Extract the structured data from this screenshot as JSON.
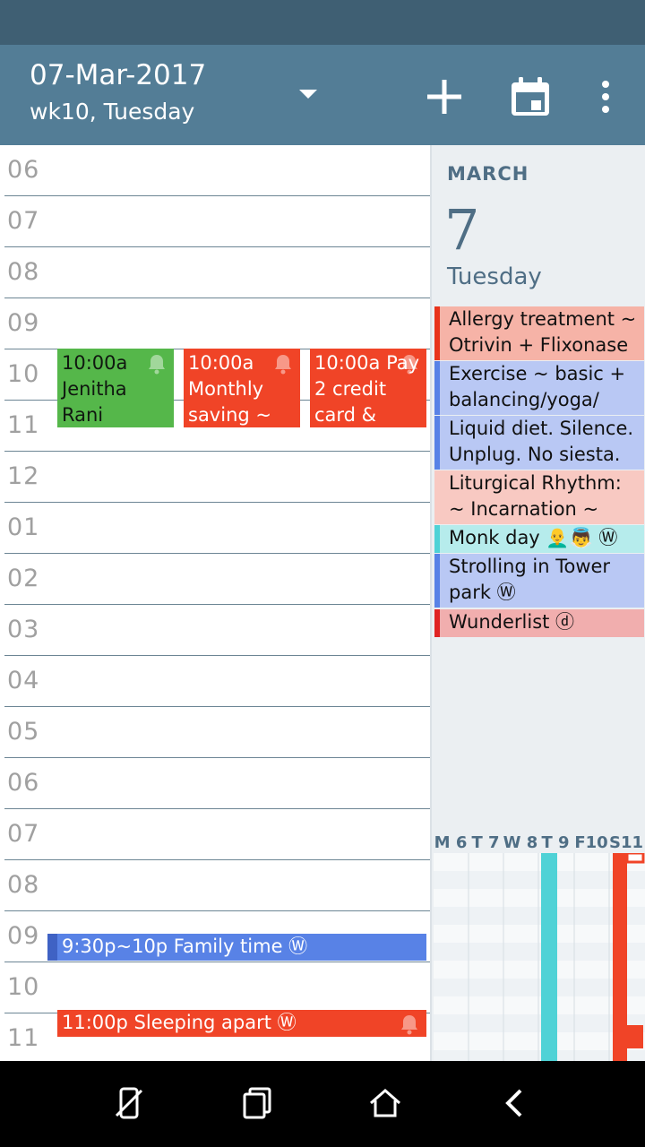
{
  "appbar": {
    "date": "07-Mar-2017",
    "week": "wk10, Tuesday"
  },
  "timegrid": {
    "hours": [
      "06",
      "07",
      "08",
      "09",
      "10",
      "11",
      "12",
      "01",
      "02",
      "03",
      "04",
      "05",
      "06",
      "07",
      "08",
      "09",
      "10",
      "11"
    ],
    "events": [
      {
        "lines": [
          "10:00a",
          "Jenitha",
          "Rani"
        ],
        "color": "#55b74a",
        "bell": true
      },
      {
        "lines": [
          "10:00a",
          "Monthly",
          "saving ~"
        ],
        "color": "#f04427",
        "bell": true
      },
      {
        "lines": [
          "10:00a Pay",
          "2 credit",
          "card &"
        ],
        "color": "#f04427",
        "bell": true
      },
      {
        "lines": [
          "9:30p~10p Family time Ⓦ"
        ],
        "color": "#5882e6",
        "bell": false
      },
      {
        "lines": [
          "11:00p Sleeping apart Ⓦ"
        ],
        "color": "#f04427",
        "bell": true
      }
    ]
  },
  "side": {
    "month": "MARCH",
    "day": "7",
    "dow": "Tuesday",
    "agenda": [
      {
        "text": "Allergy treatment ~ Otrivin + Flixonase +",
        "bg": "#f6b3a7",
        "bar": "#e8341c"
      },
      {
        "text": "Exercise ~ basic + balancing/yoga/",
        "bg": "#b9c8f4",
        "bar": "#5882e6"
      },
      {
        "text": "Liquid diet. Silence. Unplug. No siesta.",
        "bg": "#b9c8f4",
        "bar": "#5882e6"
      },
      {
        "text": "Liturgical Rhythm: ~ Incarnation ~ GOD",
        "bg": "#f8c9c2",
        "bar": "#f8c9c2"
      },
      {
        "text": "Monk day 👨‍🦲👼 Ⓦ",
        "bg": "#b6ecec",
        "bar": "#4fd2d6"
      },
      {
        "text": "Strolling in Tower park Ⓦ",
        "bg": "#b9c8f4",
        "bar": "#5882e6"
      },
      {
        "text": "Wunderlist ⓓ",
        "bg": "#f1aeae",
        "bar": "#e02424"
      }
    ],
    "week_days": [
      "M 6",
      "T 7",
      "W 8",
      "T 9",
      "F10",
      "S11"
    ]
  },
  "icons": {
    "dropdown": "chevron-down-icon",
    "add": "plus-icon",
    "calendar": "calendar-icon",
    "more": "more-vert-icon"
  }
}
